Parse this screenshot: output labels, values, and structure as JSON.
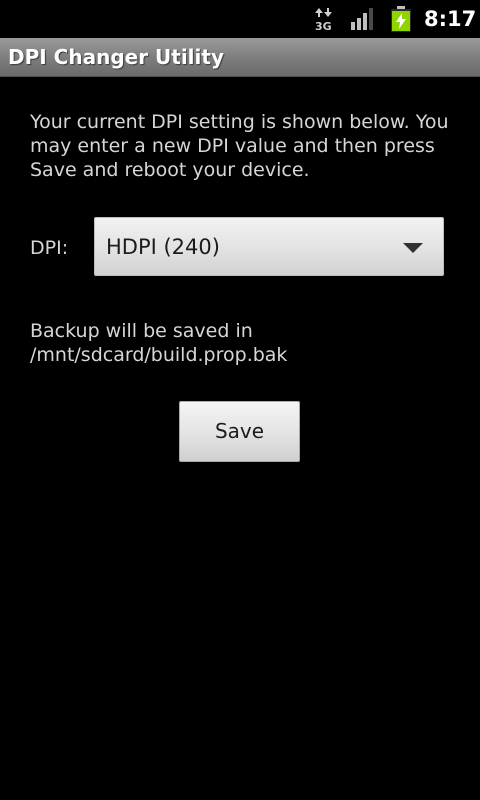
{
  "status_bar": {
    "network_type": "3G",
    "time": "8:17",
    "network_icon": "3g-data-icon",
    "signal_icon": "signal-strength-icon",
    "battery_icon": "battery-charging-icon",
    "battery_color": "#8fd400"
  },
  "app": {
    "title": "DPI Changer Utility"
  },
  "main": {
    "intro": "Your current DPI setting is shown below. You may enter a new DPI value and then press Save and reboot your device.",
    "dpi_label": "DPI:",
    "dpi_selected": "HDPI (240)",
    "backup_text": "Backup will be saved in /mnt/sdcard/build.prop.bak",
    "save_label": "Save"
  }
}
